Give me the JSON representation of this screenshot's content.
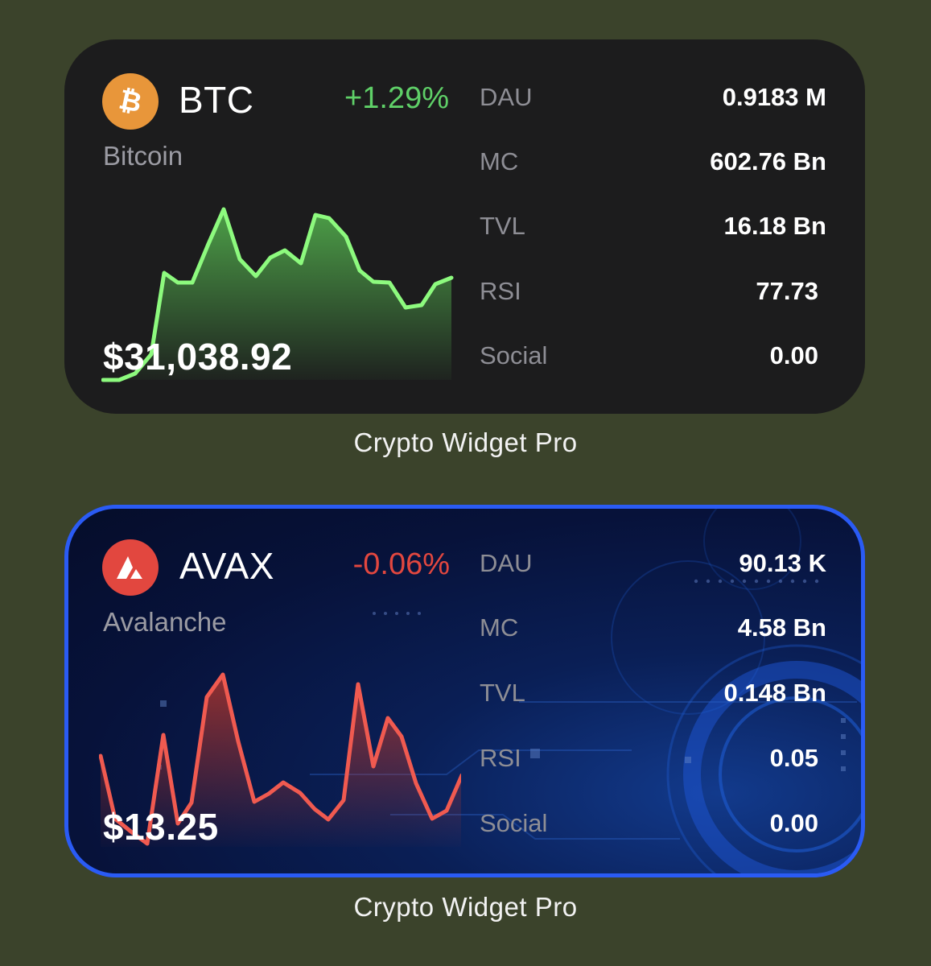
{
  "widgets": [
    {
      "ticker": "BTC",
      "name": "Bitcoin",
      "change": "+1.29%",
      "price": "$31,038.92",
      "icon": "bitcoin-icon",
      "icon_glyph": "₿",
      "icon_color": "#e8963a",
      "change_color": "#5fd068",
      "line_color": "#8dfa7e",
      "stats": [
        {
          "label": "DAU",
          "value": "0.9183 M"
        },
        {
          "label": "MC",
          "value": "602.76 Bn"
        },
        {
          "label": "TVL",
          "value": "16.18 Bn"
        },
        {
          "label": "RSI",
          "value": "77.73"
        },
        {
          "label": "Social",
          "value": "0.00"
        }
      ],
      "caption": "Crypto Widget Pro"
    },
    {
      "ticker": "AVAX",
      "name": "Avalanche",
      "change": "-0.06%",
      "price": "$13.25",
      "icon": "avalanche-icon",
      "icon_color": "#e2473f",
      "change_color": "#e2473f",
      "line_color": "#f05a50",
      "stats": [
        {
          "label": "DAU",
          "value": "90.13 K"
        },
        {
          "label": "MC",
          "value": "4.58 Bn"
        },
        {
          "label": "TVL",
          "value": "0.148 Bn"
        },
        {
          "label": "RSI",
          "value": "0.05"
        },
        {
          "label": "Social",
          "value": "0.00"
        }
      ],
      "caption": "Crypto Widget Pro",
      "selected": true
    }
  ]
}
